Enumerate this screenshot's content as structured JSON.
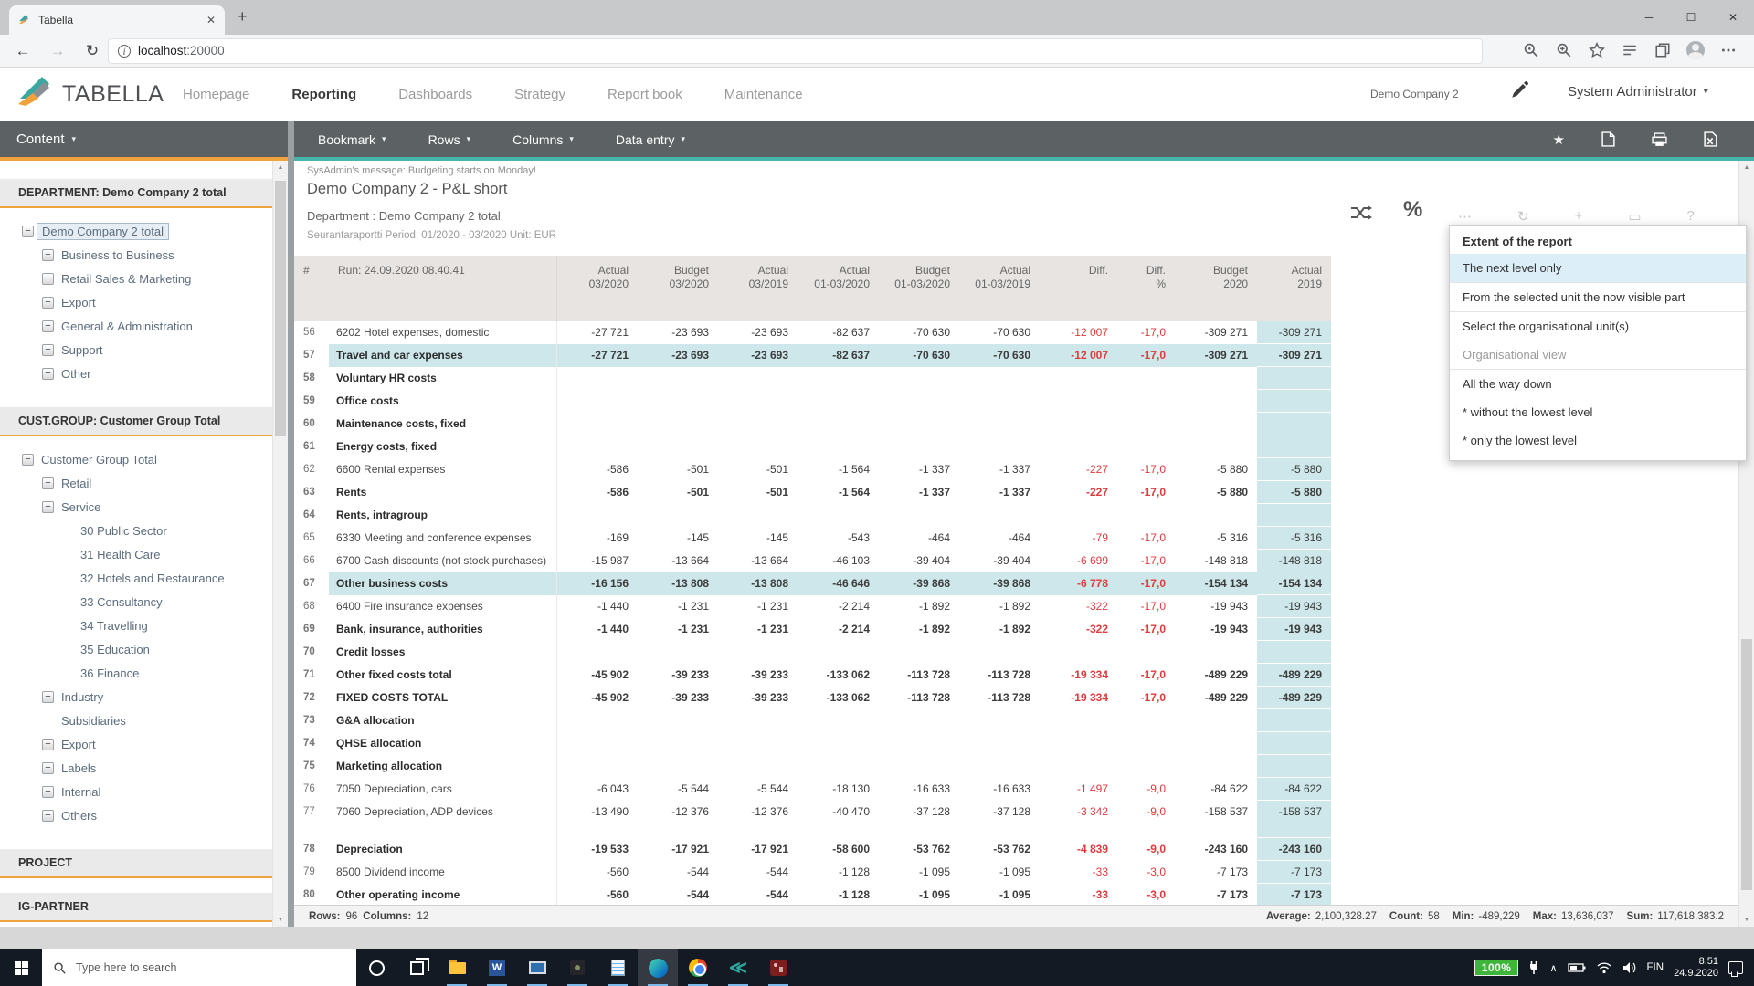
{
  "colors": {
    "accent_teal": "#46b5ac",
    "accent_orange": "#f0a23c",
    "dark_bar": "#5c6163",
    "highlight_teal": "#cde7ea",
    "negative_red": "#e03a3c",
    "taskbar_bg": "#141a23",
    "battery_green": "#3db539"
  },
  "browser": {
    "tab_title": "Tabella",
    "new_tab_glyph": "+",
    "back_glyph": "←",
    "forward_glyph": "→",
    "refresh_glyph": "↻",
    "url_host": "localhost",
    "url_port": ":20000",
    "window_controls": [
      "minimize",
      "maximize",
      "close"
    ],
    "toolbar_icon_names": [
      "find-icon",
      "zoom-icon",
      "favorite-star-icon",
      "reading-list-icon",
      "collections-icon",
      "profile-avatar",
      "more-menu-icon"
    ]
  },
  "app_header": {
    "logo_text": "TABELLA",
    "nav": [
      {
        "label": "Homepage"
      },
      {
        "label": "Reporting",
        "active": true
      },
      {
        "label": "Dashboards"
      },
      {
        "label": "Strategy"
      },
      {
        "label": "Report book"
      },
      {
        "label": "Maintenance"
      }
    ],
    "company": "Demo Company 2",
    "user": "System Administrator"
  },
  "sidebar": {
    "content_menu": "Content",
    "panels": [
      {
        "title": "DEPARTMENT: Demo Company 2 total",
        "items": [
          {
            "label": "Demo Company 2 total",
            "level": 1,
            "icon": "minus",
            "selected": true
          },
          {
            "label": "Business to Business",
            "level": 2,
            "icon": "plus"
          },
          {
            "label": "Retail Sales & Marketing",
            "level": 2,
            "icon": "plus"
          },
          {
            "label": "Export",
            "level": 2,
            "icon": "plus"
          },
          {
            "label": "General & Administration",
            "level": 2,
            "icon": "plus"
          },
          {
            "label": "Support",
            "level": 2,
            "icon": "plus"
          },
          {
            "label": "Other",
            "level": 2,
            "icon": "plus"
          }
        ]
      },
      {
        "title": "CUST.GROUP: Customer Group Total",
        "items": [
          {
            "label": "Customer Group Total",
            "level": 1,
            "icon": "minus"
          },
          {
            "label": "Retail",
            "level": 2,
            "icon": "plus"
          },
          {
            "label": "Service",
            "level": 2,
            "icon": "minus"
          },
          {
            "label": "30 Public Sector",
            "level": 3,
            "icon": "none"
          },
          {
            "label": "31 Health Care",
            "level": 3,
            "icon": "none"
          },
          {
            "label": "32 Hotels and Restaurance",
            "level": 3,
            "icon": "none"
          },
          {
            "label": "33 Consultancy",
            "level": 3,
            "icon": "none"
          },
          {
            "label": "34 Travelling",
            "level": 3,
            "icon": "none"
          },
          {
            "label": "35 Education",
            "level": 3,
            "icon": "none"
          },
          {
            "label": "36 Finance",
            "level": 3,
            "icon": "none"
          },
          {
            "label": "Industry",
            "level": 2,
            "icon": "plus"
          },
          {
            "label": "Subsidiaries",
            "level": 2,
            "icon": "none"
          },
          {
            "label": "Export",
            "level": 2,
            "icon": "plus"
          },
          {
            "label": "Labels",
            "level": 2,
            "icon": "plus"
          },
          {
            "label": "Internal",
            "level": 2,
            "icon": "plus"
          },
          {
            "label": "Others",
            "level": 2,
            "icon": "plus"
          }
        ]
      },
      {
        "title": "PROJECT",
        "items": []
      },
      {
        "title": "IG-PARTNER",
        "items": []
      }
    ]
  },
  "toolbar": {
    "menus": [
      "Bookmark",
      "Rows",
      "Columns",
      "Data entry"
    ],
    "icon_names": [
      "favorite-star-icon",
      "document-icon",
      "print-icon",
      "excel-export-icon"
    ]
  },
  "report": {
    "admin_message": "SysAdmin's message: Budgeting starts on Monday!",
    "title": "Demo Company 2 - P&L short",
    "department": "Department : Demo Company 2 total",
    "period": "Seurantaraportti Period: 01/2020 - 03/2020 Unit: EUR",
    "background_icons": [
      {
        "name": "more-dots-icon",
        "glyph": "⋯"
      },
      {
        "name": "refresh-icon",
        "glyph": "↻"
      },
      {
        "name": "add-icon",
        "glyph": "+"
      },
      {
        "name": "window-icon",
        "glyph": "▭"
      },
      {
        "name": "help-icon",
        "glyph": "?"
      }
    ]
  },
  "popup": {
    "title": "Extent of the report",
    "items": [
      {
        "label": "The next level only",
        "state": "selected",
        "sep": true
      },
      {
        "label": "From the selected unit the now visible part",
        "state": "normal",
        "sep": true
      },
      {
        "label": "Select the organisational unit(s)",
        "state": "normal",
        "sep": false
      },
      {
        "label": "Organisational view",
        "state": "muted",
        "sep": true
      },
      {
        "label": "All the way down",
        "state": "normal",
        "sep": false
      },
      {
        "label": "* without the lowest level",
        "state": "normal",
        "sep": false
      },
      {
        "label": "* only the lowest level",
        "state": "normal",
        "sep": false
      }
    ]
  },
  "table": {
    "num_header": "#",
    "run_header": "Run: 24.09.2020 08.40.41",
    "columns": [
      {
        "l1": "Actual",
        "l2": "03/2020"
      },
      {
        "l1": "Budget",
        "l2": "03/2020"
      },
      {
        "l1": "Actual",
        "l2": "03/2019"
      },
      {
        "l1": "Actual",
        "l2": "01-03/2020"
      },
      {
        "l1": "Budget",
        "l2": "01-03/2020"
      },
      {
        "l1": "Actual",
        "l2": "01-03/2019"
      },
      {
        "l1": "",
        "l2": "Diff."
      },
      {
        "l1": "Diff.",
        "l2": "%"
      },
      {
        "l1": "Budget",
        "l2": "2020"
      },
      {
        "l1": "Actual",
        "l2": "2019"
      }
    ],
    "rows": [
      {
        "n": "56",
        "label": "6202 Hotel expenses, domestic",
        "c": [
          "-27 721",
          "-23 693",
          "-23 693",
          "-82 637",
          "-70 630",
          "-70 630",
          "-12 007",
          "-17,0",
          "-309 271",
          "-309 271"
        ]
      },
      {
        "n": "57",
        "label": "Travel and car expenses",
        "bold": true,
        "hl": true,
        "c": [
          "-27 721",
          "-23 693",
          "-23 693",
          "-82 637",
          "-70 630",
          "-70 630",
          "-12 007",
          "-17,0",
          "-309 271",
          "-309 271"
        ]
      },
      {
        "n": "58",
        "label": "Voluntary HR costs",
        "bold": true,
        "c": [
          "",
          "",
          "",
          "",
          "",
          "",
          "",
          "",
          "",
          ""
        ]
      },
      {
        "n": "59",
        "label": "Office costs",
        "bold": true,
        "c": [
          "",
          "",
          "",
          "",
          "",
          "",
          "",
          "",
          "",
          ""
        ]
      },
      {
        "n": "60",
        "label": "Maintenance costs, fixed",
        "bold": true,
        "c": [
          "",
          "",
          "",
          "",
          "",
          "",
          "",
          "",
          "",
          ""
        ]
      },
      {
        "n": "61",
        "label": "Energy costs, fixed",
        "bold": true,
        "c": [
          "",
          "",
          "",
          "",
          "",
          "",
          "",
          "",
          "",
          ""
        ]
      },
      {
        "n": "62",
        "label": "6600 Rental expenses",
        "c": [
          "-586",
          "-501",
          "-501",
          "-1 564",
          "-1 337",
          "-1 337",
          "-227",
          "-17,0",
          "-5 880",
          "-5 880"
        ]
      },
      {
        "n": "63",
        "label": "Rents",
        "bold": true,
        "c": [
          "-586",
          "-501",
          "-501",
          "-1 564",
          "-1 337",
          "-1 337",
          "-227",
          "-17,0",
          "-5 880",
          "-5 880"
        ]
      },
      {
        "n": "64",
        "label": "Rents, intragroup",
        "bold": true,
        "c": [
          "",
          "",
          "",
          "",
          "",
          "",
          "",
          "",
          "",
          ""
        ]
      },
      {
        "n": "65",
        "label": "6330 Meeting and conference expenses",
        "c": [
          "-169",
          "-145",
          "-145",
          "-543",
          "-464",
          "-464",
          "-79",
          "-17,0",
          "-5 316",
          "-5 316"
        ]
      },
      {
        "n": "66",
        "label": "6700 Cash discounts (not stock purchases)",
        "c": [
          "-15 987",
          "-13 664",
          "-13 664",
          "-46 103",
          "-39 404",
          "-39 404",
          "-6 699",
          "-17,0",
          "-148 818",
          "-148 818"
        ]
      },
      {
        "n": "67",
        "label": "Other business costs",
        "bold": true,
        "hl": true,
        "c": [
          "-16 156",
          "-13 808",
          "-13 808",
          "-46 646",
          "-39 868",
          "-39 868",
          "-6 778",
          "-17,0",
          "-154 134",
          "-154 134"
        ]
      },
      {
        "n": "68",
        "label": "6400 Fire insurance expenses",
        "c": [
          "-1 440",
          "-1 231",
          "-1 231",
          "-2 214",
          "-1 892",
          "-1 892",
          "-322",
          "-17,0",
          "-19 943",
          "-19 943"
        ]
      },
      {
        "n": "69",
        "label": "Bank, insurance, authorities",
        "bold": true,
        "c": [
          "-1 440",
          "-1 231",
          "-1 231",
          "-2 214",
          "-1 892",
          "-1 892",
          "-322",
          "-17,0",
          "-19 943",
          "-19 943"
        ]
      },
      {
        "n": "70",
        "label": "Credit losses",
        "bold": true,
        "c": [
          "",
          "",
          "",
          "",
          "",
          "",
          "",
          "",
          "",
          ""
        ]
      },
      {
        "n": "71",
        "label": "Other fixed costs total",
        "bold": true,
        "c": [
          "-45 902",
          "-39 233",
          "-39 233",
          "-133 062",
          "-113 728",
          "-113 728",
          "-19 334",
          "-17,0",
          "-489 229",
          "-489 229"
        ]
      },
      {
        "n": "72",
        "label": "FIXED COSTS TOTAL",
        "bold": true,
        "c": [
          "-45 902",
          "-39 233",
          "-39 233",
          "-133 062",
          "-113 728",
          "-113 728",
          "-19 334",
          "-17,0",
          "-489 229",
          "-489 229"
        ]
      },
      {
        "n": "73",
        "label": "G&A allocation",
        "bold": true,
        "c": [
          "",
          "",
          "",
          "",
          "",
          "",
          "",
          "",
          "",
          ""
        ]
      },
      {
        "n": "74",
        "label": "QHSE allocation",
        "bold": true,
        "c": [
          "",
          "",
          "",
          "",
          "",
          "",
          "",
          "",
          "",
          ""
        ]
      },
      {
        "n": "75",
        "label": "Marketing allocation",
        "bold": true,
        "c": [
          "",
          "",
          "",
          "",
          "",
          "",
          "",
          "",
          "",
          ""
        ]
      },
      {
        "n": "76",
        "label": "7050 Depreciation, cars",
        "c": [
          "-6 043",
          "-5 544",
          "-5 544",
          "-18 130",
          "-16 633",
          "-16 633",
          "-1 497",
          "-9,0",
          "-84 622",
          "-84 622"
        ]
      },
      {
        "n": "77",
        "label": "7060 Depreciation, ADP devices",
        "c": [
          "-13 490",
          "-12 376",
          "-12 376",
          "-40 470",
          "-37 128",
          "-37 128",
          "-3 342",
          "-9,0",
          "-158 537",
          "-158 537"
        ]
      },
      {
        "spacer": true
      },
      {
        "n": "78",
        "label": "Depreciation",
        "bold": true,
        "c": [
          "-19 533",
          "-17 921",
          "-17 921",
          "-58 600",
          "-53 762",
          "-53 762",
          "-4 839",
          "-9,0",
          "-243 160",
          "-243 160"
        ]
      },
      {
        "n": "79",
        "label": "8500 Dividend income",
        "c": [
          "-560",
          "-544",
          "-544",
          "-1 128",
          "-1 095",
          "-1 095",
          "-33",
          "-3,0",
          "-7 173",
          "-7 173"
        ]
      },
      {
        "n": "80",
        "label": "Other operating income",
        "bold": true,
        "c": [
          "-560",
          "-544",
          "-544",
          "-1 128",
          "-1 095",
          "-1 095",
          "-33",
          "-3,0",
          "-7 173",
          "-7 173"
        ]
      }
    ]
  },
  "statusbar": {
    "rows_label": "Rows:",
    "rows_value": "96",
    "cols_label": "Columns:",
    "cols_value": "12",
    "stats": [
      {
        "label": "Average:",
        "value": "2,100,328.27"
      },
      {
        "label": "Count:",
        "value": "58"
      },
      {
        "label": "Min:",
        "value": "-489,229"
      },
      {
        "label": "Max:",
        "value": "13,636,037"
      },
      {
        "label": "Sum:",
        "value": "117,618,383.2"
      }
    ]
  },
  "taskbar": {
    "search_placeholder": "Type here to search",
    "apps": [
      {
        "name": "cortana"
      },
      {
        "name": "task-view"
      },
      {
        "name": "file-explorer",
        "open": true
      },
      {
        "name": "word",
        "open": true
      },
      {
        "name": "remote-desktop",
        "open": true
      },
      {
        "name": "dark-app",
        "open": true
      },
      {
        "name": "notepad",
        "open": true
      },
      {
        "name": "edge",
        "open": true,
        "active": true
      },
      {
        "name": "chrome",
        "open": true
      },
      {
        "name": "tabella",
        "open": true
      },
      {
        "name": "red-app",
        "open": true
      }
    ],
    "tray": {
      "battery": "100%",
      "chevron_glyph": "∧",
      "language": "FIN",
      "time": "8.51",
      "date": "24.9.2020",
      "icon_names": [
        "plug-icon",
        "chevron-up-icon",
        "battery-icon",
        "wifi-icon",
        "volume-icon",
        "notification-icon"
      ]
    }
  }
}
